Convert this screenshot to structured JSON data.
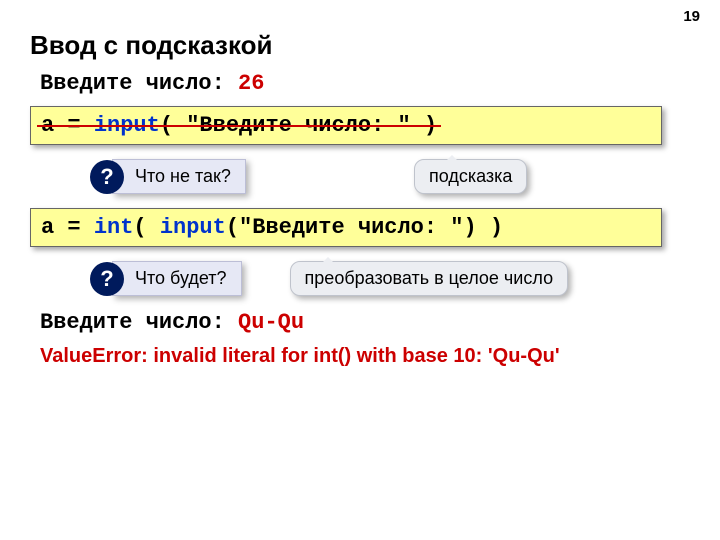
{
  "page_number": "19",
  "title": "Ввод с подсказкой",
  "example1": {
    "prompt_label": "Введите число: ",
    "prompt_value": "26",
    "code": {
      "var": "a = ",
      "fn": "input",
      "args": "( \"Введите число: \" )"
    }
  },
  "q1": {
    "label": "Что не так?",
    "callout": "подсказка"
  },
  "example2": {
    "code": {
      "var": "a = ",
      "fn_outer": "int",
      "paren1": "( ",
      "fn_inner": "input",
      "args": "(\"Введите число: \")",
      "paren2": " )"
    }
  },
  "q2": {
    "label": "Что будет?",
    "callout": "преобразовать в целое число"
  },
  "example3": {
    "prompt_label": "Введите число: ",
    "prompt_value": "Qu-Qu"
  },
  "error": "ValueError: invalid literal for int() with base 10: 'Qu-Qu'"
}
